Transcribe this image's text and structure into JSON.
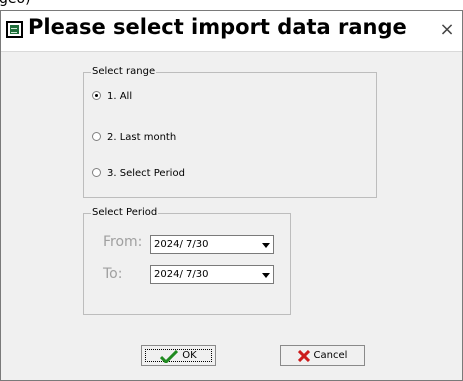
{
  "dialog": {
    "title": "Please select import data range",
    "close_glyph": "×",
    "app_icon": "spreadsheet-icon"
  },
  "select_range": {
    "label": "Select range",
    "options": [
      {
        "label": "1. All",
        "selected": true
      },
      {
        "label": "2. Last month",
        "selected": false
      },
      {
        "label": "3. Select Period",
        "selected": false
      }
    ]
  },
  "select_period": {
    "label": "Select Period",
    "enabled": false,
    "from_label": "From:",
    "from_value": "2024/ 7/30",
    "to_label": "To:",
    "to_value": "2024/ 7/30"
  },
  "buttons": {
    "ok_label": "OK",
    "ok_icon": "checkmark-icon",
    "cancel_label": "Cancel",
    "cancel_icon": "x-mark-icon"
  },
  "colors": {
    "ok_check": "#1f8a1f",
    "cancel_x": "#cc1b1b",
    "disabled_text": "#a0a0a0"
  }
}
